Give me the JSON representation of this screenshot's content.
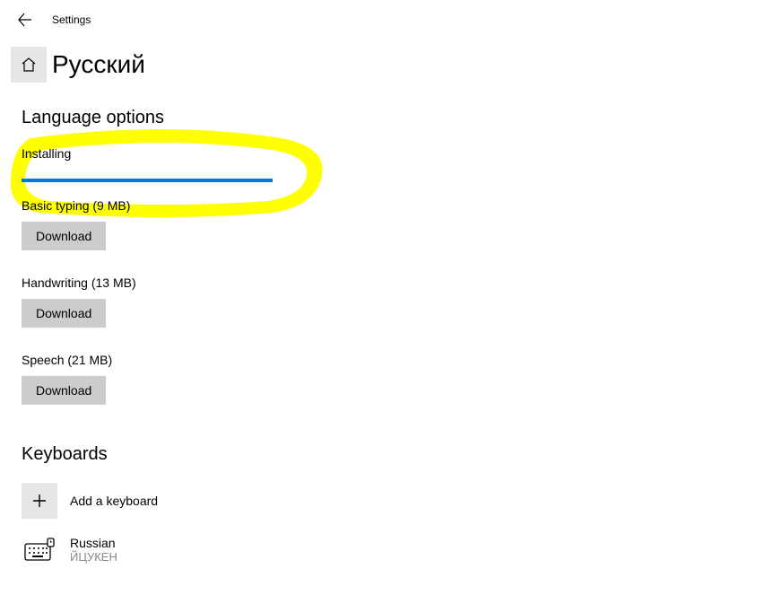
{
  "header": {
    "app_name": "Settings"
  },
  "page": {
    "title": "Русский"
  },
  "language_options": {
    "heading": "Language options",
    "installing_label": "Installing",
    "items": [
      {
        "label": "Basic typing (9 MB)",
        "button": "Download"
      },
      {
        "label": "Handwriting (13 MB)",
        "button": "Download"
      },
      {
        "label": "Speech (21 MB)",
        "button": "Download"
      }
    ]
  },
  "keyboards": {
    "heading": "Keyboards",
    "add_label": "Add a keyboard",
    "items": [
      {
        "name": "Russian",
        "layout": "ЙЦУКЕН"
      }
    ]
  }
}
